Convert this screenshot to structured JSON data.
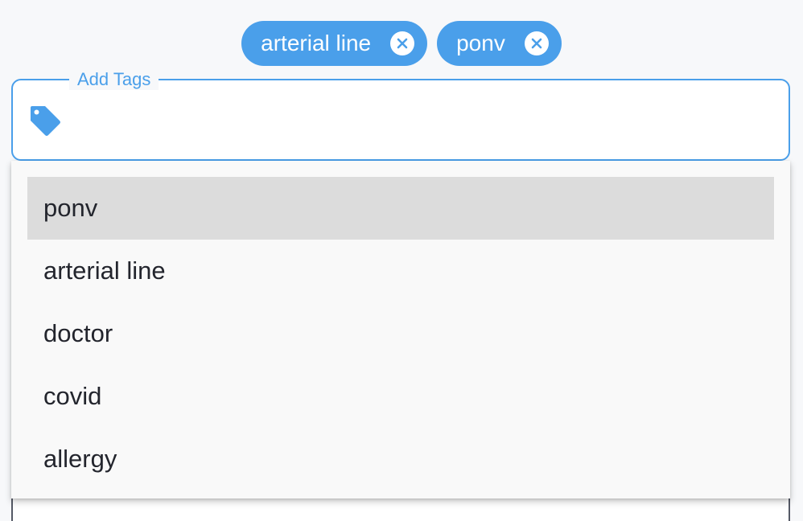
{
  "chips": [
    {
      "label": "arterial line"
    },
    {
      "label": "ponv"
    }
  ],
  "field": {
    "legend": "Add Tags",
    "value": "",
    "icon": "tag-icon"
  },
  "menu": {
    "items": [
      {
        "label": "ponv",
        "highlighted": true
      },
      {
        "label": "arterial line",
        "highlighted": false
      },
      {
        "label": "doctor",
        "highlighted": false
      },
      {
        "label": "covid",
        "highlighted": false
      },
      {
        "label": "allergy",
        "highlighted": false
      }
    ]
  },
  "colors": {
    "accent": "#4a9fea",
    "highlight": "#dcdcdc",
    "text": "#23252d"
  }
}
